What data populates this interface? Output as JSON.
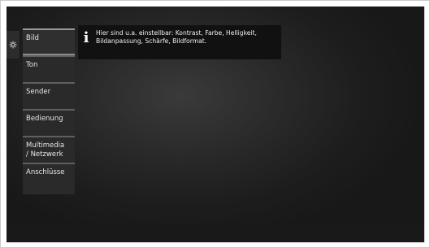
{
  "menu": {
    "items": [
      {
        "label": "Bild",
        "active": true
      },
      {
        "label": "Ton",
        "active": false
      },
      {
        "label": "Sender",
        "active": false
      },
      {
        "label": "Bedienung",
        "active": false
      },
      {
        "label": "Multimedia\n/ Netzwerk",
        "active": false
      },
      {
        "label": "Anschlüsse",
        "active": false
      }
    ]
  },
  "info": {
    "icon": "info-icon",
    "text": "Hier sind u.a. einstellbar: Kontrast, Farbe, Helligkeit,\nBildanpassung, Schärfe, Bildformat."
  },
  "settings_tab": {
    "icon": "gear-icon"
  }
}
